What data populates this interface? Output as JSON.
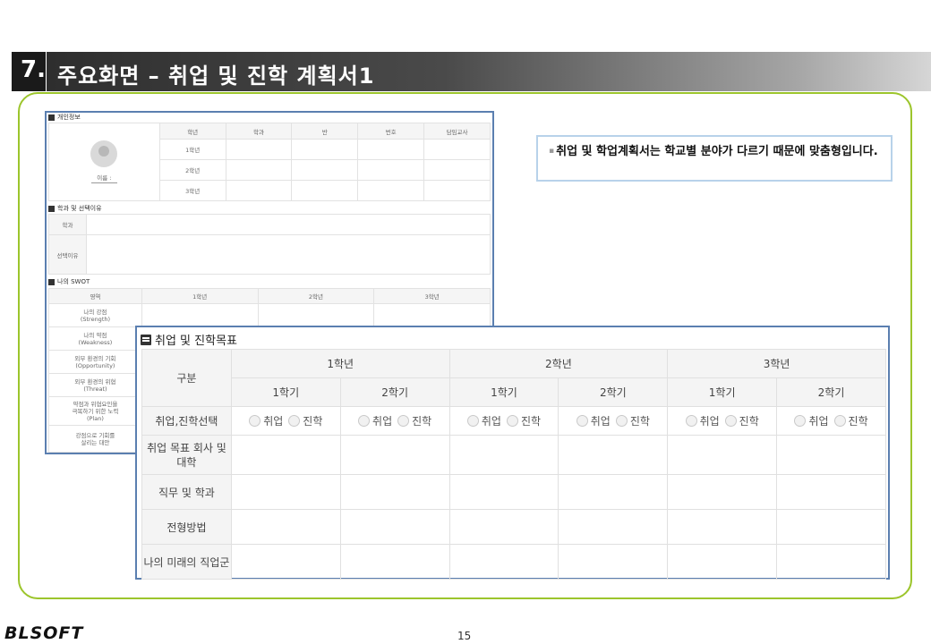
{
  "header": {
    "number": "7.",
    "title": "주요화면 – 취업 및 진학 계획서1"
  },
  "note": {
    "bullet": "▪",
    "text": "취업 및 학업계획서는 학교별 분야가 다르기 때문에 맞춤형입니다."
  },
  "small_form": {
    "personal": {
      "title": "개인정보",
      "headers": [
        "학년",
        "학과",
        "반",
        "번호",
        "담임교사"
      ],
      "rows": [
        "1학년",
        "2학년",
        "3학년"
      ],
      "name_label": "이름 :"
    },
    "dept": {
      "title": "학과 및 선택이유",
      "rows": [
        "학과",
        "선택이유"
      ]
    },
    "swot": {
      "title": "나의 SWOT",
      "headers": [
        "영역",
        "1학년",
        "2학년",
        "3학년"
      ],
      "rows": [
        "나의 강점\n(Strength)",
        "나의 약점\n(Weakness)",
        "외부 환경의 기회\n(Opportunity)",
        "외부 환경의 위협\n(Threat)",
        "약점과 위협요인을\n극복하기 위한 노력\n(Plan)",
        "강점으로 기회를\n살리는 대안"
      ]
    }
  },
  "big_form": {
    "title": "취업 및 진학목표",
    "corner": "구분",
    "years": [
      "1학년",
      "2학년",
      "3학년"
    ],
    "terms": [
      "1학기",
      "2학기",
      "1학기",
      "2학기",
      "1학기",
      "2학기"
    ],
    "select_label": "취업,진학선택",
    "opt_job": "취업",
    "opt_school": "진학",
    "rows": [
      "취업 목표 회사 및 대학",
      "직무 및 학과",
      "전형방법",
      "나의 미래의 직업군"
    ]
  },
  "footer": {
    "logo": "BLSOFT",
    "page": "15"
  }
}
